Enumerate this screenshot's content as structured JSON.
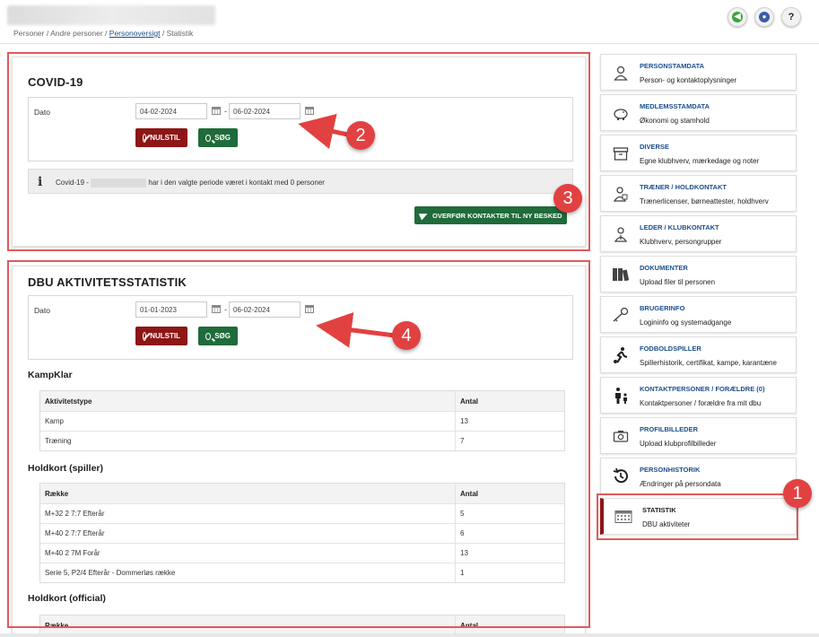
{
  "breadcrumb": {
    "part1": "Personer / Andre personer / ",
    "link": "Personoversigt",
    "part2": " / Statistik"
  },
  "top_icons": [
    "back-icon",
    "help-icon",
    "question-icon"
  ],
  "question_label": "?",
  "covid": {
    "title": "COVID-19",
    "date_label": "Dato",
    "from": "04-02-2024",
    "to": "06-02-2024",
    "dash": "-",
    "reset_label": "NULSTIL",
    "search_label": "SØG",
    "info_prefix": "Covid-19 -",
    "info_suffix": "har i den valgte periode været i kontakt med 0 personer",
    "transfer_label": "OVERFØR KONTAKTER TIL NY BESKED"
  },
  "dbu": {
    "title": "DBU AKTIVITETSSTATISTIK",
    "date_label": "Dato",
    "from": "01-01-2023",
    "to": "06-02-2024",
    "dash": "-",
    "reset_label": "NULSTIL",
    "search_label": "SØG",
    "kampklar": {
      "title": "KampKlar",
      "headers": [
        "Aktivitetstype",
        "Antal"
      ],
      "rows": [
        [
          "Kamp",
          "13"
        ],
        [
          "Træning",
          "7"
        ]
      ]
    },
    "holdkort_spiller": {
      "title": "Holdkort (spiller)",
      "headers": [
        "Række",
        "Antal"
      ],
      "rows": [
        [
          "M+32 2 7:7 Efterår",
          "5"
        ],
        [
          "M+40 2 7:7 Efterår",
          "6"
        ],
        [
          "M+40 2 7M Forår",
          "13"
        ],
        [
          "Serie 5, P2/4 Efterår - Dommerløs række",
          "1"
        ]
      ]
    },
    "holdkort_official": {
      "title": "Holdkort (official)",
      "headers": [
        "Række",
        "Antal"
      ]
    }
  },
  "sidebar": {
    "items": [
      {
        "title": "PERSONSTAMDATA",
        "sub": "Person- og kontaktoplysninger",
        "icon": "person-icon"
      },
      {
        "title": "MEDLEMSSTAMDATA",
        "sub": "Økonomi og stamhold",
        "icon": "piggy-bank-icon"
      },
      {
        "title": "DIVERSE",
        "sub": "Egne klubhverv, mærkedage og noter",
        "icon": "archive-box-icon"
      },
      {
        "title": "TRÆNER / HOLDKONTAKT",
        "sub": "Trænerlicenser, børneattester, holdhverv",
        "icon": "coach-icon"
      },
      {
        "title": "LEDER / KLUBKONTAKT",
        "sub": "Klubhverv, persongrupper",
        "icon": "leader-icon"
      },
      {
        "title": "DOKUMENTER",
        "sub": "Upload filer til personen",
        "icon": "binders-icon"
      },
      {
        "title": "BRUGERINFO",
        "sub": "Logininfo og systemadgange",
        "icon": "key-icon"
      },
      {
        "title": "FODBOLDSPILLER",
        "sub": "Spillerhistorik, certifikat, kampe, karantæne",
        "icon": "football-player-icon"
      },
      {
        "title": "KONTAKTPERSONER / FORÆLDRE (0)",
        "sub": "Kontaktpersoner / forældre fra mit dbu",
        "icon": "family-icon"
      },
      {
        "title": "PROFILBILLEDER",
        "sub": "Upload klubprofilbilleder",
        "icon": "camera-icon"
      },
      {
        "title": "PERSONHISTORIK",
        "sub": "Ændringer på persondata",
        "icon": "history-icon"
      },
      {
        "title": "STATISTIK",
        "sub": "DBU aktiviteter",
        "icon": "calendar-grid-icon"
      }
    ]
  },
  "callouts": [
    "1",
    "2",
    "3",
    "4"
  ],
  "colors": {
    "primary": "#1a4f8b",
    "reset": "#8d1616",
    "search": "#1f6b3a",
    "annotation": "#e24141"
  }
}
